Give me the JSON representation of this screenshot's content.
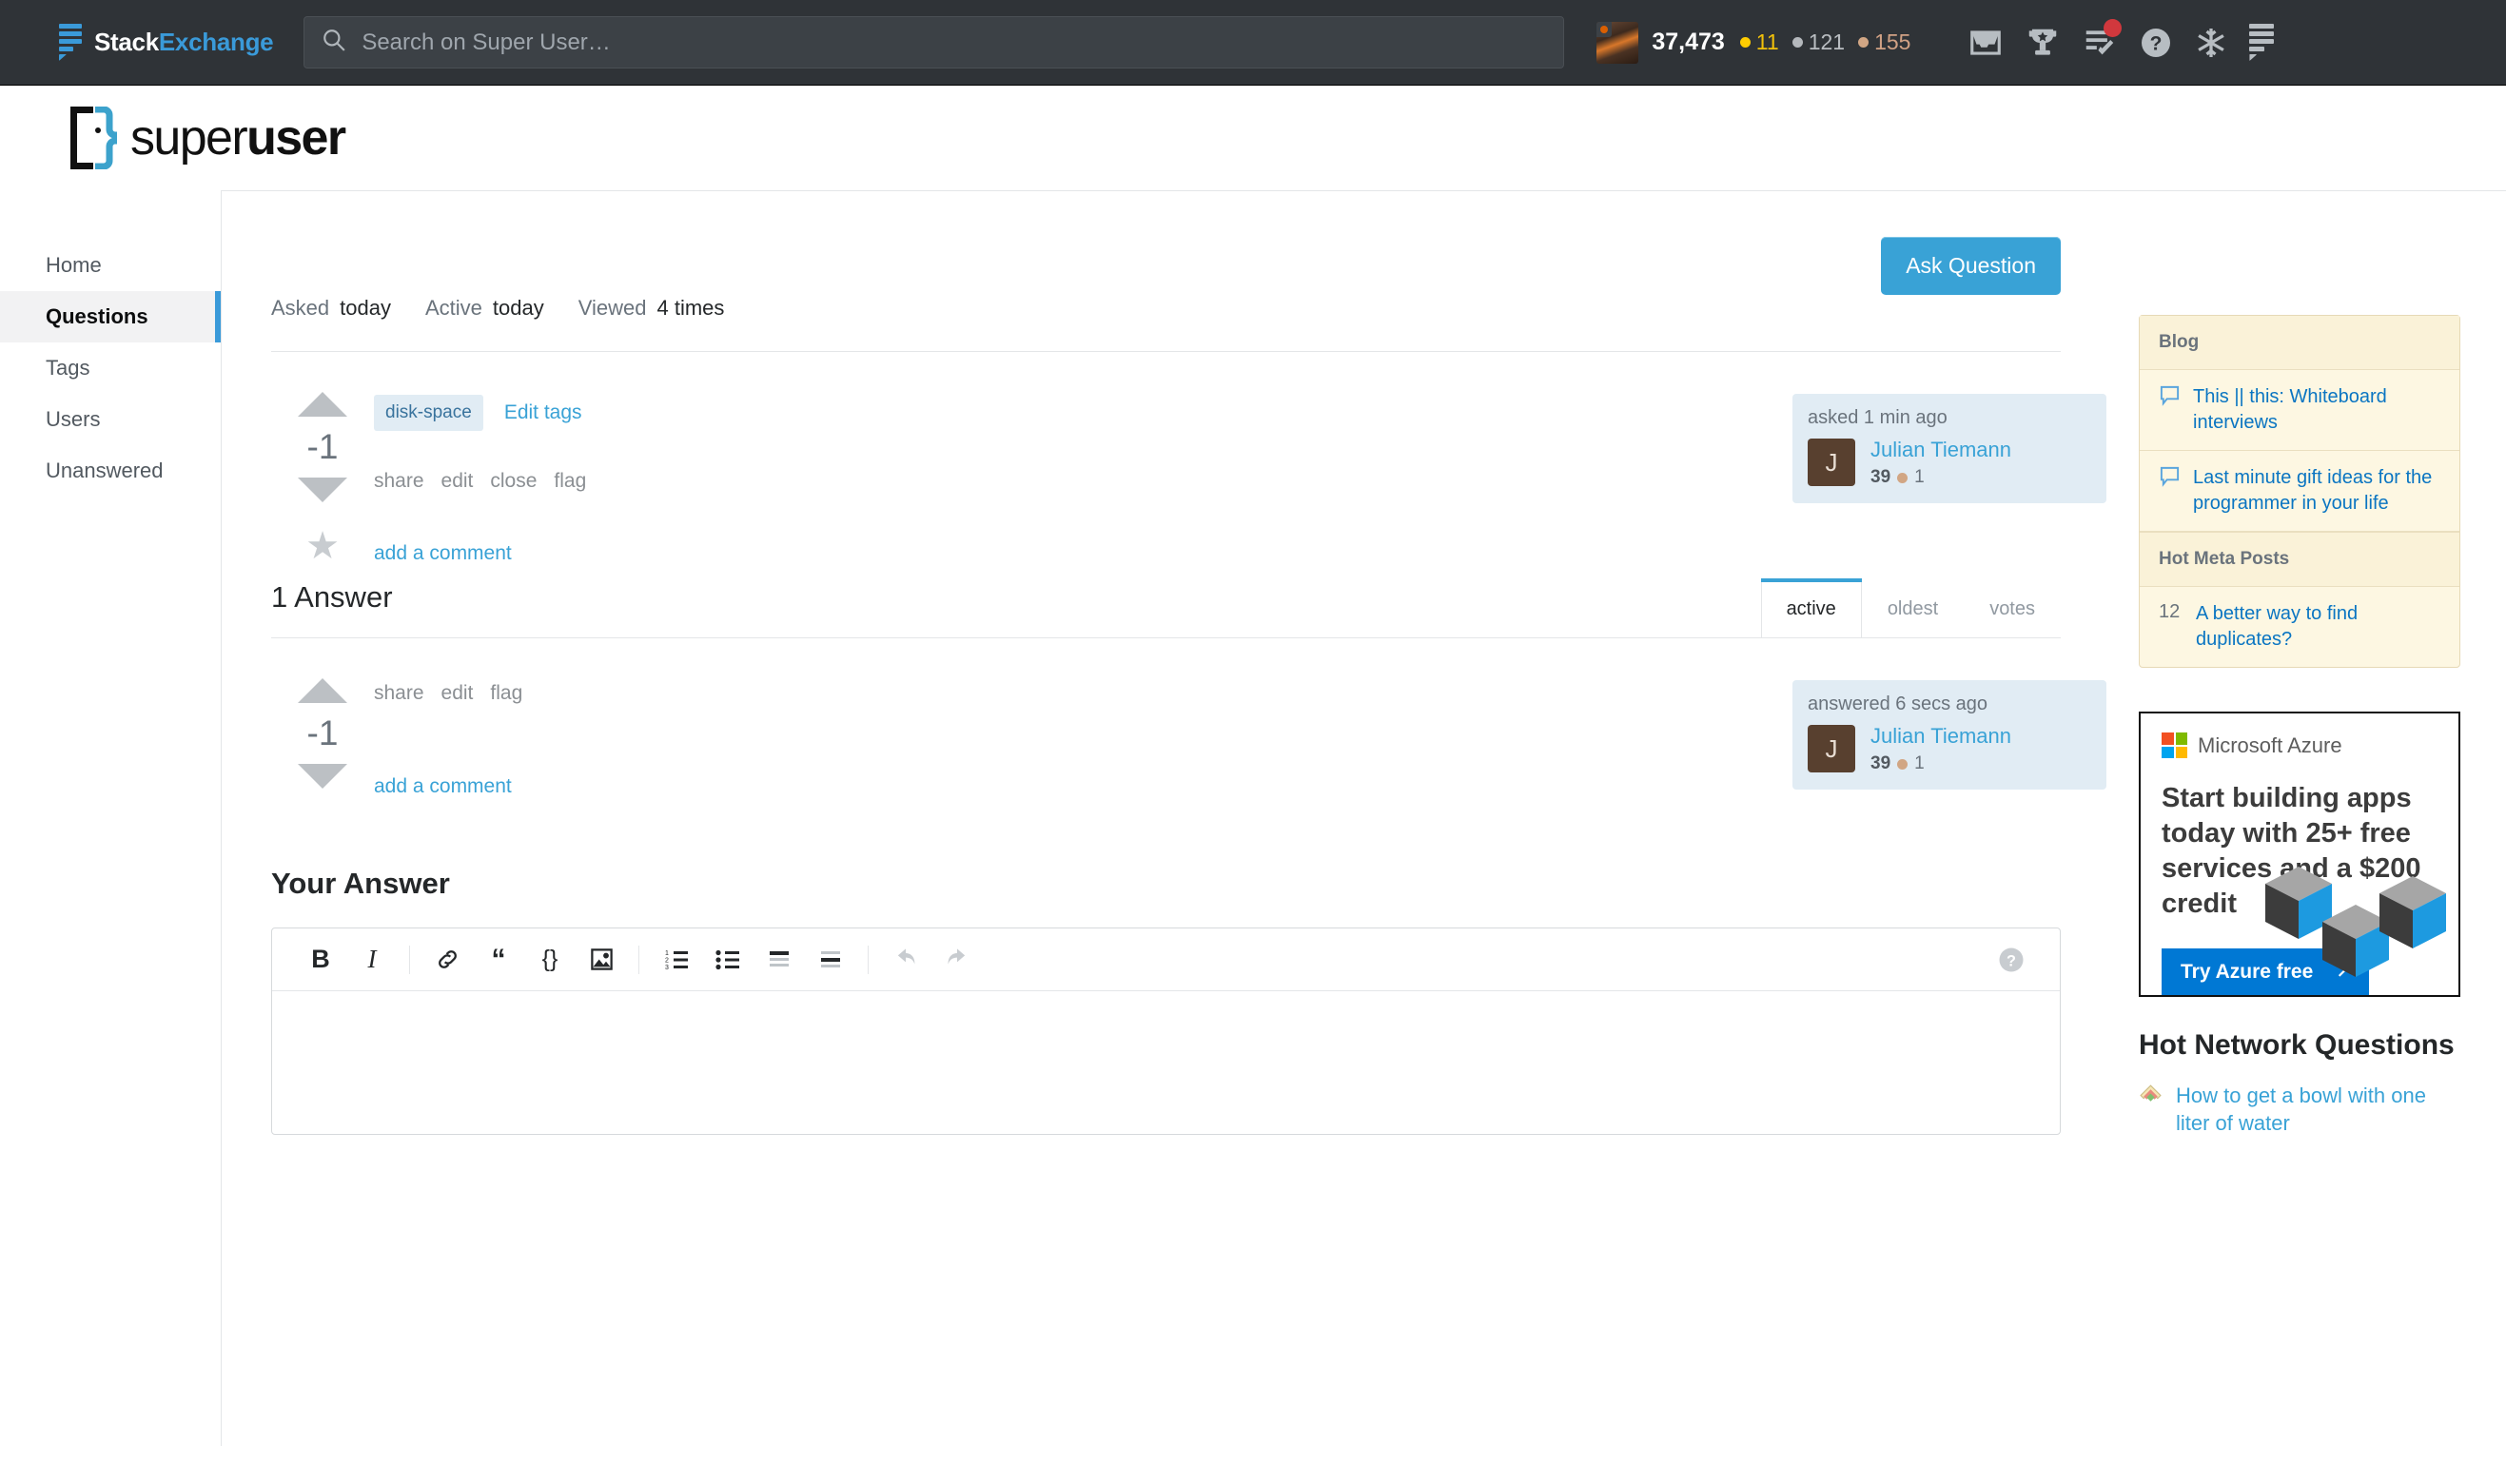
{
  "topbar": {
    "network_name_a": "Stack",
    "network_name_b": "Exchange",
    "search_placeholder": "Search on Super User…",
    "search_value": "",
    "reputation": "37,473",
    "badges": {
      "gold": "11",
      "silver": "121",
      "bronze": "155"
    },
    "icons": [
      "inbox-icon",
      "achievements-trophy-icon",
      "review-queues-icon",
      "help-icon",
      "snowflake-icon",
      "site-switcher-icon"
    ]
  },
  "site": {
    "logo_text_a": "super",
    "logo_text_b": "user"
  },
  "sidebar": {
    "items": [
      {
        "label": "Home",
        "active": false
      },
      {
        "label": "Questions",
        "active": true
      },
      {
        "label": "Tags",
        "active": false
      },
      {
        "label": "Users",
        "active": false
      },
      {
        "label": "Unanswered",
        "active": false
      }
    ]
  },
  "main": {
    "ask_button": "Ask Question",
    "stats": [
      {
        "label": "Asked",
        "value": "today"
      },
      {
        "label": "Active",
        "value": "today"
      },
      {
        "label": "Viewed",
        "value": "4 times"
      }
    ],
    "question": {
      "score": "-1",
      "tags": [
        "disk-space"
      ],
      "edit_tags": "Edit tags",
      "actions": [
        "share",
        "edit",
        "close",
        "flag"
      ],
      "add_comment": "add a comment",
      "user": {
        "action_time": "asked 1 min ago",
        "avatar_letter": "J",
        "name": "Julian Tiemann",
        "reputation": "39",
        "bronze_badges": "1"
      }
    },
    "answers_title": "1 Answer",
    "answer_tabs": [
      {
        "label": "active",
        "active": true
      },
      {
        "label": "oldest",
        "active": false
      },
      {
        "label": "votes",
        "active": false
      }
    ],
    "answer": {
      "score": "-1",
      "actions": [
        "share",
        "edit",
        "flag"
      ],
      "add_comment": "add a comment",
      "user": {
        "action_time": "answered 6 secs ago",
        "avatar_letter": "J",
        "name": "Julian Tiemann",
        "reputation": "39",
        "bronze_badges": "1"
      }
    },
    "your_answer_title": "Your Answer",
    "editor": {
      "value": "",
      "buttons": [
        "bold-icon",
        "italic-icon",
        "link-icon",
        "blockquote-icon",
        "code-icon",
        "image-icon",
        "numbered-list-icon",
        "bulleted-list-icon",
        "heading-icon",
        "horizontal-rule-icon",
        "undo-icon",
        "redo-icon",
        "help-icon"
      ],
      "bold_label": "B",
      "italic_label": "I",
      "code_label": "{}"
    }
  },
  "rightbar": {
    "blog": {
      "title": "Blog",
      "items": [
        "This || this: Whiteboard interviews",
        "Last minute gift ideas for the programmer in your life"
      ]
    },
    "hot_meta": {
      "title": "Hot Meta Posts",
      "items": [
        {
          "count": "12",
          "title": "A better way to find duplicates?"
        }
      ]
    },
    "ad": {
      "brand": "Microsoft Azure",
      "headline": "Start building apps today with 25+ free services and a $200 credit",
      "cta": "Try Azure free"
    },
    "hot_network": {
      "title": "Hot Network Questions",
      "items": [
        "How to get a bowl with one liter of water"
      ]
    }
  },
  "colors": {
    "accent_blue": "#39a2d6",
    "link_blue": "#0a75c2",
    "topbar_bg": "#2f3337",
    "tag_bg": "#e1ecf4",
    "tag_text": "#39739d",
    "panel_bg": "#fdf7e2",
    "azure_blue": "#0078d4"
  }
}
